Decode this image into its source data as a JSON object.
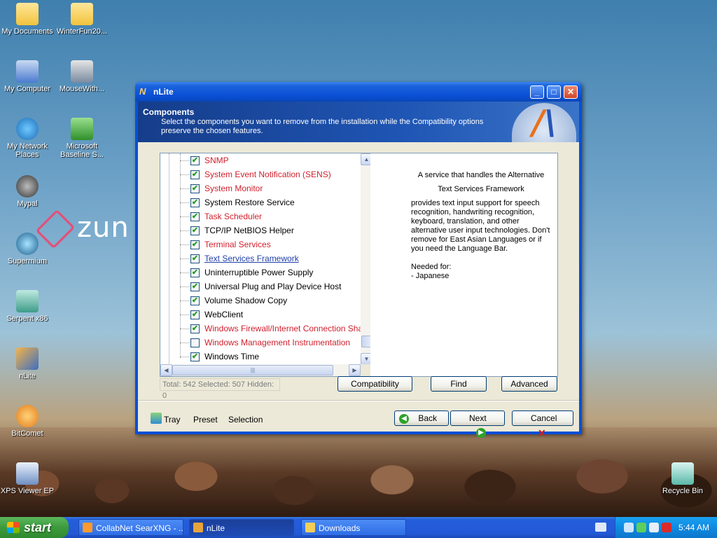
{
  "desktop": {
    "icons": [
      {
        "label": "My Documents"
      },
      {
        "label": "WinterFun20..."
      },
      {
        "label": "My Computer"
      },
      {
        "label": "MouseWith..."
      },
      {
        "label": "My Network Places"
      },
      {
        "label": "Microsoft Baseline S..."
      },
      {
        "label": "Mypal"
      },
      {
        "label": "Supermium"
      },
      {
        "label": "Serpent x86"
      },
      {
        "label": "nLite"
      },
      {
        "label": "BitComet"
      },
      {
        "label": "XPS Viewer EP"
      },
      {
        "label": "Recycle Bin"
      }
    ],
    "wallpaper_text": "zun"
  },
  "window": {
    "title": "nLite",
    "buttons": {
      "minimize": "_",
      "maximize": "□",
      "close": "✕"
    },
    "banner": {
      "title": "Components",
      "description": "Select the components you want to remove from the installation while the Compatibility options preserve the chosen features."
    },
    "components": [
      {
        "name": "SNMP",
        "checked": true,
        "style": "red"
      },
      {
        "name": "System Event Notification (SENS)",
        "checked": true,
        "style": "red"
      },
      {
        "name": "System Monitor",
        "checked": true,
        "style": "red"
      },
      {
        "name": "System Restore Service",
        "checked": true,
        "style": "normal"
      },
      {
        "name": "Task Scheduler",
        "checked": true,
        "style": "red"
      },
      {
        "name": "TCP/IP NetBIOS Helper",
        "checked": true,
        "style": "normal"
      },
      {
        "name": "Terminal Services",
        "checked": true,
        "style": "red"
      },
      {
        "name": "Text Services Framework",
        "checked": true,
        "style": "link"
      },
      {
        "name": "Uninterruptible Power Supply",
        "checked": true,
        "style": "normal"
      },
      {
        "name": "Universal Plug and Play Device Host",
        "checked": true,
        "style": "normal"
      },
      {
        "name": "Volume Shadow Copy",
        "checked": true,
        "style": "normal"
      },
      {
        "name": "WebClient",
        "checked": true,
        "style": "normal"
      },
      {
        "name": "Windows Firewall/Internet Connection Sharing (",
        "checked": true,
        "style": "red"
      },
      {
        "name": "Windows Management Instrumentation",
        "checked": false,
        "style": "red"
      },
      {
        "name": "Windows Time",
        "checked": true,
        "style": "normal"
      }
    ],
    "description": {
      "line1": "A service that handles the Alternative",
      "line2": "Text Services Framework",
      "body": "provides text input support for speech recognition, handwriting recognition, keyboard, translation, and other alternative user input technologies. Don't remove for East Asian Languages or if you need the Language Bar.",
      "needed_for_label": "Needed for:",
      "needed_for_item": " - Japanese"
    },
    "status": "Total: 542 Selected: 507 Hidden: 0",
    "actions": {
      "compatibility": "Compatibility",
      "find": "Find",
      "advanced": "Advanced"
    },
    "footer": {
      "tray": "Tray",
      "preset": "Preset",
      "selection": "Selection",
      "back": "Back",
      "next": "Next",
      "cancel": "Cancel"
    }
  },
  "taskbar": {
    "start": "start",
    "tasks": [
      {
        "label": "CollabNet SearXNG - ..."
      },
      {
        "label": "nLite"
      },
      {
        "label": "Downloads"
      }
    ],
    "clock": "5:44 AM"
  },
  "colors": {
    "xp_blue": "#0a4fd6",
    "red_item": "#d0202e",
    "link_item": "#1f3fa8",
    "start_green": "#3c9a3c"
  }
}
